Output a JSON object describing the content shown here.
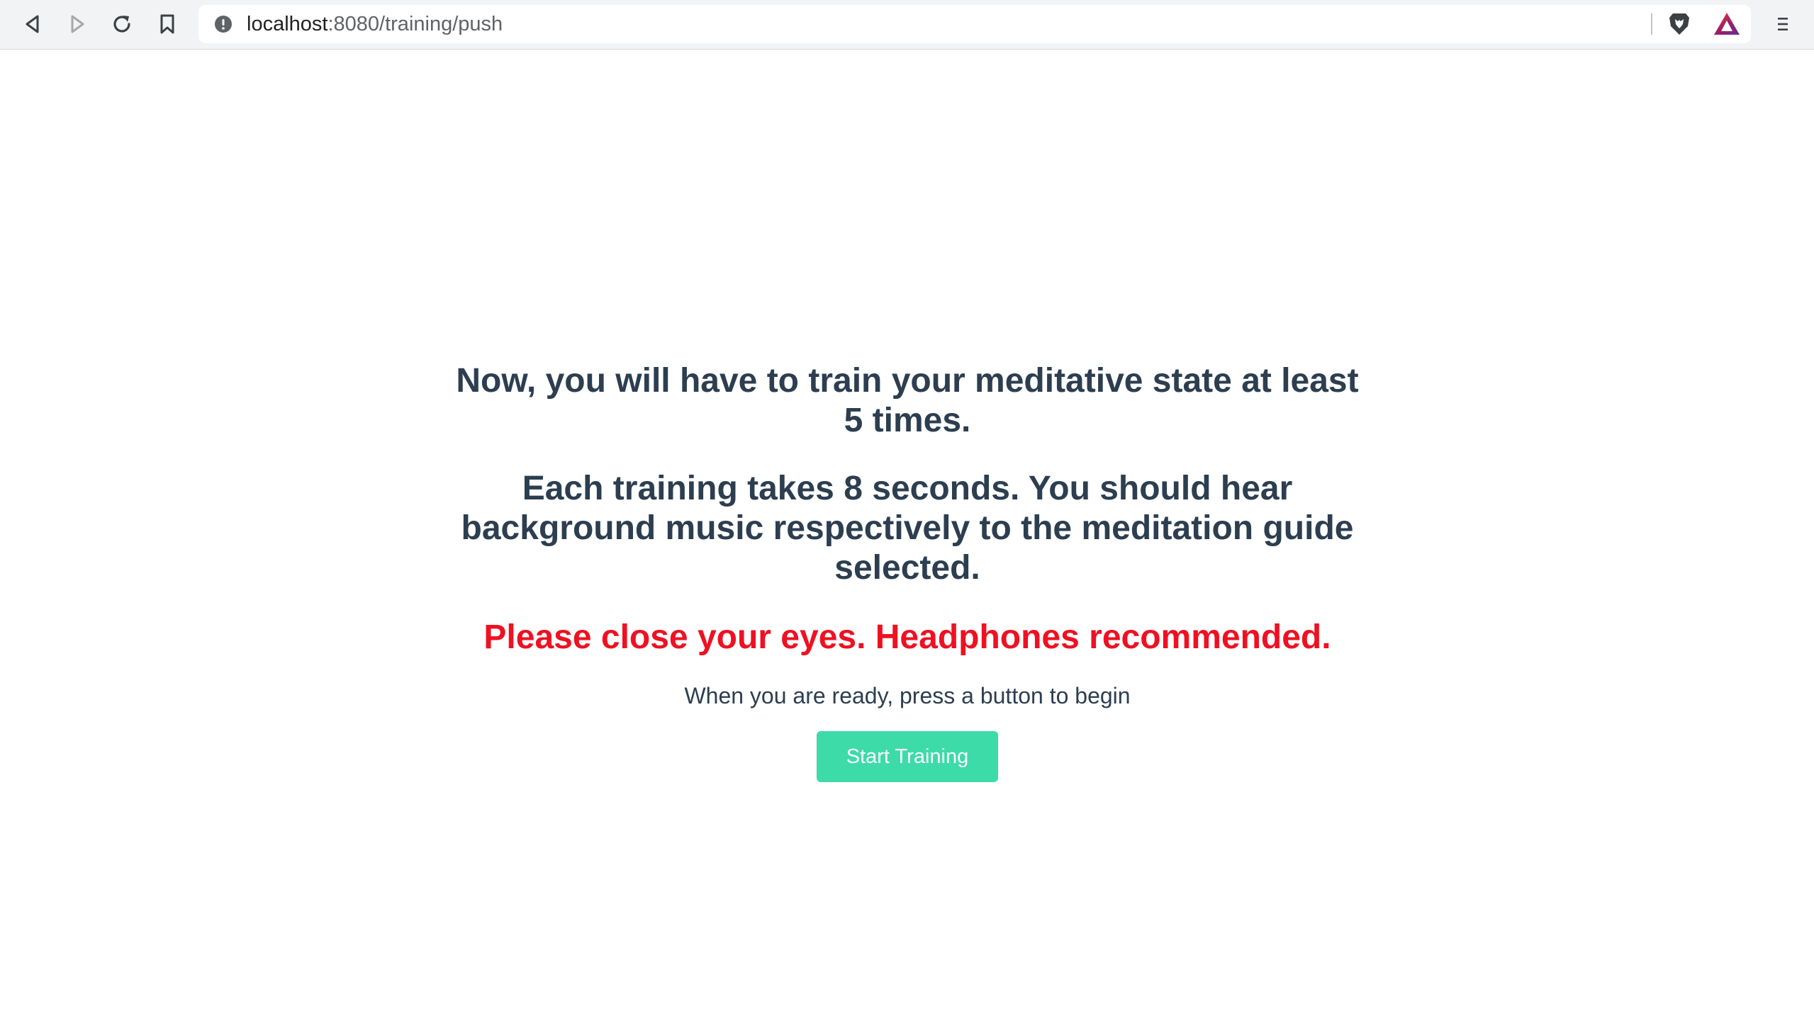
{
  "browser": {
    "url_host": "localhost",
    "url_path": ":8080/training/push",
    "icons": {
      "back": "back-arrow-icon",
      "forward": "forward-arrow-icon",
      "reload": "reload-icon",
      "bookmark": "bookmark-icon",
      "site_info": "info-icon",
      "brave_shields": "brave-lion-icon",
      "rewards": "bat-triangle-icon",
      "menu": "hamburger-menu-icon"
    }
  },
  "main": {
    "heading_1": "Now, you will have to train your meditative state at least 5 times.",
    "heading_2": "Each training takes 8 seconds. You should hear background music respectively to the meditation guide selected.",
    "warning": "Please close your eyes. Headphones recommended.",
    "hint": "When you are ready, press a button to begin",
    "start_button_label": "Start Training"
  },
  "colors": {
    "text": "#2c3e50",
    "warning": "#ee1122",
    "button": "#3ddba8",
    "button_text": "#ffffff"
  }
}
